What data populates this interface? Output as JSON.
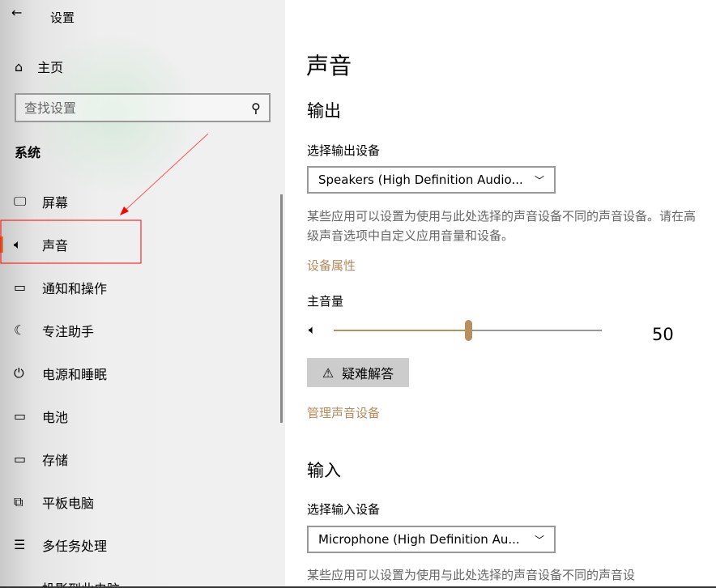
{
  "app": {
    "title": "设置",
    "back_icon": "arrow-left-icon"
  },
  "sidebar": {
    "home": "主页",
    "search_placeholder": "查找设置",
    "section": "系统",
    "items": [
      {
        "label": "屏幕",
        "icon": "monitor-icon"
      },
      {
        "label": "声音",
        "icon": "speaker-icon",
        "active": true
      },
      {
        "label": "通知和操作",
        "icon": "message-icon"
      },
      {
        "label": "专注助手",
        "icon": "moon-icon"
      },
      {
        "label": "电源和睡眠",
        "icon": "power-icon"
      },
      {
        "label": "电池",
        "icon": "battery-icon"
      },
      {
        "label": "存储",
        "icon": "storage-icon"
      },
      {
        "label": "平板电脑",
        "icon": "tablet-icon"
      },
      {
        "label": "多任务处理",
        "icon": "multitask-icon"
      },
      {
        "label": "投影到此电脑",
        "icon": "project-icon"
      }
    ]
  },
  "main": {
    "title": "声音",
    "output": {
      "heading": "输出",
      "device_label": "选择输出设备",
      "device_value": "Speakers (High Definition Audio...",
      "description": "某些应用可以设置为使用与此处选择的声音设备不同的声音设备。请在高级声音选项中自定义应用音量和设备。",
      "properties_link": "设备属性",
      "volume_label": "主音量",
      "volume": 50,
      "volume_text": "50",
      "troubleshoot": "疑难解答",
      "manage_link": "管理声音设备"
    },
    "input": {
      "heading": "输入",
      "device_label": "选择输入设备",
      "device_value": "Microphone (High Definition Au...",
      "description": "某些应用可以设置为使用与此处选择的声音设备不同的声音设"
    }
  },
  "colors": {
    "accent": "#b88f60",
    "annotation": "#ff0000"
  }
}
